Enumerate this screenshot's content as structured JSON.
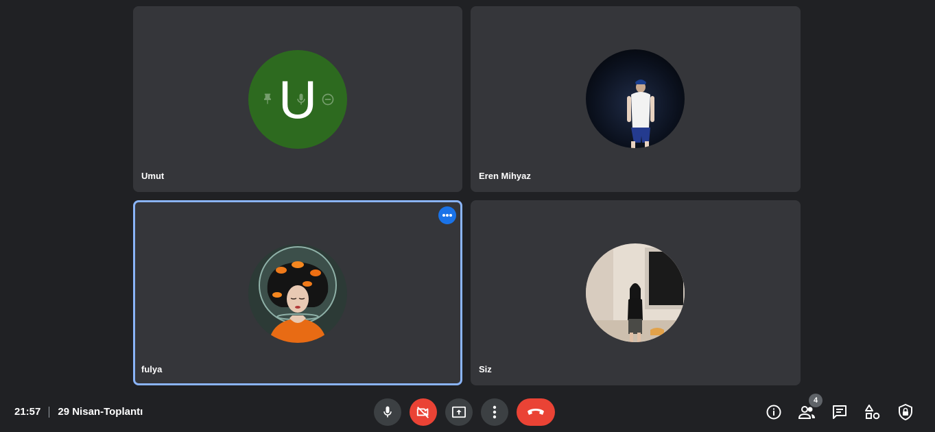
{
  "participants": [
    {
      "name": "Umut",
      "initial": "U",
      "avatar_color": "#2d6a1f",
      "avatar_icon": "letter-avatar"
    },
    {
      "name": "Eren Mihyaz",
      "avatar_icon": "photo-avatar-night"
    },
    {
      "name": "fulya",
      "avatar_icon": "photo-avatar-goldfish",
      "active": true
    },
    {
      "name": "Siz",
      "avatar_icon": "photo-avatar-room"
    }
  ],
  "meeting": {
    "time": "21:57",
    "title": "29 Nisan-Toplantı"
  },
  "controls": {
    "mic_icon": "mic-icon",
    "camera_icon": "camera-off-icon",
    "present_icon": "present-screen-icon",
    "more_icon": "more-vert-icon",
    "hangup_icon": "call-end-icon"
  },
  "right_panel": {
    "people_count": "4",
    "icons": [
      "info-icon",
      "people-icon",
      "chat-icon",
      "activities-icon",
      "host-controls-icon"
    ]
  },
  "colors": {
    "background": "#202124",
    "tile": "#35363a",
    "active_border": "#8ab4f8",
    "danger": "#ea4335",
    "accent": "#1a73e8"
  }
}
